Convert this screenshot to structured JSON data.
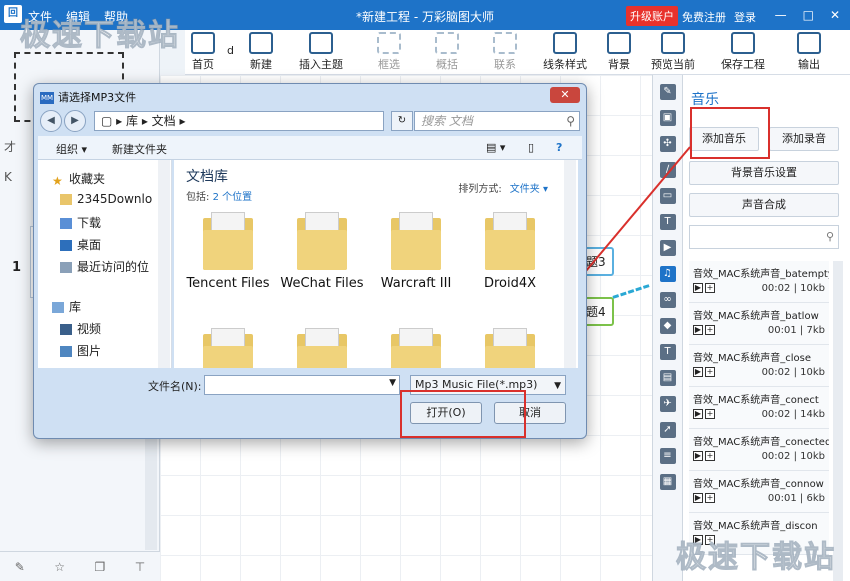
{
  "window": {
    "title": "*新建工程 - 万彩脑图大师",
    "logo": "回",
    "menu": [
      "文件",
      "编辑",
      "帮助"
    ],
    "upgrade_label": "升级账户",
    "register_label": "免费注册",
    "login_label": "登录",
    "controls": [
      "—",
      "□",
      "✕"
    ]
  },
  "toolbar": {
    "home": "首页",
    "new": "新建",
    "insert_topic": "插入主题",
    "select": "框选",
    "summary": "概括",
    "link": "联系",
    "line_style": "线条样式",
    "background": "背景",
    "preview": "预览当前",
    "save": "保存工程",
    "export": "输出",
    "partial": "d"
  },
  "canvas": {
    "topic3": "题3",
    "topic4": "题4"
  },
  "left_panel": {
    "slide_number": "1",
    "partial_a": "才",
    "partial_k": "K"
  },
  "music_panel": {
    "title": "音乐",
    "add_music": "添加音乐",
    "add_record": "添加录音",
    "bg_settings": "背景音乐设置",
    "synthesis": "声音合成",
    "sounds": [
      {
        "name": "音效_MAC系统声音_batempty",
        "time": "00:02",
        "size": "10kb"
      },
      {
        "name": "音效_MAC系统声音_batlow",
        "time": "00:01",
        "size": "7kb"
      },
      {
        "name": "音效_MAC系统声音_close",
        "time": "00:02",
        "size": "10kb"
      },
      {
        "name": "音效_MAC系统声音_conect",
        "time": "00:02",
        "size": "14kb"
      },
      {
        "name": "音效_MAC系统声音_conected",
        "time": "00:02",
        "size": "10kb"
      },
      {
        "name": "音效_MAC系统声音_connow",
        "time": "00:01",
        "size": "6kb"
      },
      {
        "name": "音效_MAC系统声音_discon",
        "time": "",
        "size": ""
      }
    ]
  },
  "dialog": {
    "title": "请选择MP3文件",
    "title_icon": "MM",
    "breadcrumb": [
      "库",
      "文档"
    ],
    "search_placeholder": "搜索 文档",
    "organize": "组织 ▾",
    "new_folder": "新建文件夹",
    "nav_items": [
      {
        "label": "收藏夹",
        "icon": "star-icon"
      },
      {
        "label": "2345Downlo",
        "icon": "folder-icon"
      },
      {
        "label": "下载",
        "icon": "download-folder-icon"
      },
      {
        "label": "桌面",
        "icon": "desktop-icon"
      },
      {
        "label": "最近访问的位",
        "icon": "recent-places-icon"
      },
      {
        "label": "库",
        "icon": "library-icon"
      },
      {
        "label": "视频",
        "icon": "video-library-icon"
      },
      {
        "label": "图片",
        "icon": "picture-library-icon"
      }
    ],
    "library_title": "文档库",
    "includes_label": "包括:",
    "includes_link": "2 个位置",
    "sort_label": "排列方式:",
    "sort_value": "文件夹 ▾",
    "folders": [
      "Tencent Files",
      "WeChat Files",
      "Warcraft III",
      "Droid4X"
    ],
    "filename_label": "文件名(N):",
    "filename_value": "",
    "filetype": "Mp3 Music File(*.mp3)",
    "open_button": "打开(O)",
    "cancel_button": "取消"
  },
  "watermarks": [
    "极速下载站",
    "极速下载站"
  ]
}
